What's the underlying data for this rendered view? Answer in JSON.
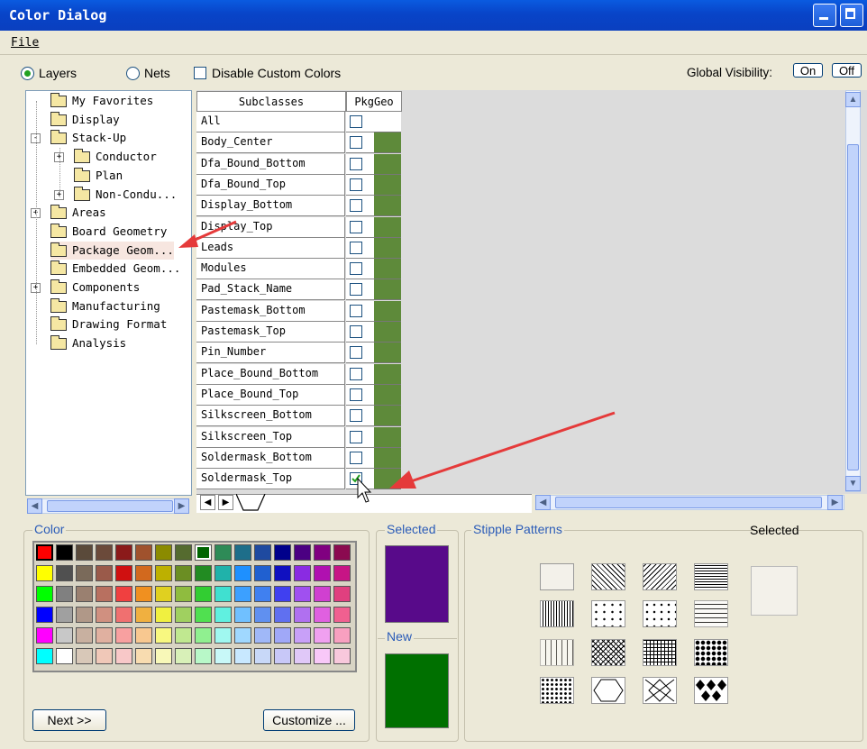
{
  "window": {
    "title": "Color Dialog"
  },
  "menu": {
    "file_label": "File"
  },
  "toolbar": {
    "layers_label": "Layers",
    "nets_label": "Nets",
    "disable_custom_label": "Disable Custom Colors",
    "global_visibility_label": "Global Visibility:",
    "on_label": "On",
    "off_label": "Off",
    "selected_radio": "Layers"
  },
  "tree": {
    "items": [
      {
        "label": "My Favorites",
        "level": 0,
        "expander": ""
      },
      {
        "label": "Display",
        "level": 0,
        "expander": ""
      },
      {
        "label": "Stack-Up",
        "level": 0,
        "expander": "-"
      },
      {
        "label": "Conductor",
        "level": 1,
        "expander": "+"
      },
      {
        "label": "Plan",
        "level": 1,
        "expander": ""
      },
      {
        "label": "Non-Condu...",
        "level": 1,
        "expander": "+"
      },
      {
        "label": "Areas",
        "level": 0,
        "expander": "+"
      },
      {
        "label": "Board Geometry",
        "level": 0,
        "expander": ""
      },
      {
        "label": "Package Geom...",
        "level": 0,
        "expander": "",
        "selected": true
      },
      {
        "label": "Embedded Geom...",
        "level": 0,
        "expander": ""
      },
      {
        "label": "Components",
        "level": 0,
        "expander": "+"
      },
      {
        "label": "Manufacturing",
        "level": 0,
        "expander": ""
      },
      {
        "label": "Drawing Format",
        "level": 0,
        "expander": ""
      },
      {
        "label": "Analysis",
        "level": 0,
        "expander": ""
      }
    ]
  },
  "grid": {
    "header_subclasses": "Subclasses",
    "header_col": "PkgGeo",
    "rows": [
      {
        "name": "All",
        "checked": false
      },
      {
        "name": "Body_Center",
        "checked": false
      },
      {
        "name": "Dfa_Bound_Bottom",
        "checked": false
      },
      {
        "name": "Dfa_Bound_Top",
        "checked": false
      },
      {
        "name": "Display_Bottom",
        "checked": false
      },
      {
        "name": "Display_Top",
        "checked": false
      },
      {
        "name": "Leads",
        "checked": false
      },
      {
        "name": "Modules",
        "checked": false
      },
      {
        "name": "Pad_Stack_Name",
        "checked": false
      },
      {
        "name": "Pastemask_Bottom",
        "checked": false
      },
      {
        "name": "Pastemask_Top",
        "checked": false
      },
      {
        "name": "Pin_Number",
        "checked": false
      },
      {
        "name": "Place_Bound_Bottom",
        "checked": false
      },
      {
        "name": "Place_Bound_Top",
        "checked": false
      },
      {
        "name": "Silkscreen_Bottom",
        "checked": false
      },
      {
        "name": "Silkscreen_Top",
        "checked": false
      },
      {
        "name": "Soldermask_Bottom",
        "checked": false
      },
      {
        "name": "Soldermask_Top",
        "checked": true
      }
    ],
    "layer_color": "#5e8a3a"
  },
  "color_panel": {
    "label": "Color",
    "next_label": "Next >>",
    "customize_label": "Customize ...",
    "palette": [
      [
        "#ff0000",
        "#000000",
        "#5a4a3a",
        "#6b4a3a",
        "#8b1a1a",
        "#a0522d",
        "#8b8b00",
        "#556b2f",
        "#006400",
        "#2e8b57",
        "#1e6e8a",
        "#1f4aa0",
        "#00008b",
        "#4b0082",
        "#800080",
        "#8b0a50"
      ],
      [
        "#ffff00",
        "#505050",
        "#7a6a5a",
        "#9a5a4a",
        "#d01010",
        "#d2691e",
        "#bdb000",
        "#6b8e23",
        "#228b22",
        "#20b2aa",
        "#1e90ff",
        "#2060d0",
        "#1010c0",
        "#8a2be2",
        "#b010b0",
        "#c71585"
      ],
      [
        "#00ff00",
        "#808080",
        "#9a8070",
        "#b87060",
        "#f04040",
        "#f09020",
        "#e0d020",
        "#8fbc3f",
        "#32cd32",
        "#40e0d0",
        "#3ca0ff",
        "#4080f0",
        "#4040f0",
        "#a050f0",
        "#d040d0",
        "#e0407f"
      ],
      [
        "#0000ff",
        "#a0a0a0",
        "#b09888",
        "#d09080",
        "#f07070",
        "#f0b040",
        "#f0f040",
        "#a0d060",
        "#50e050",
        "#60f0e0",
        "#70c0ff",
        "#6090f0",
        "#6070f0",
        "#b070f0",
        "#e060e0",
        "#f06090"
      ],
      [
        "#ff00ff",
        "#c8c8c8",
        "#c8b0a0",
        "#e0b0a0",
        "#f8a0a0",
        "#f8c890",
        "#f8f880",
        "#c0e890",
        "#90f090",
        "#a0f8f0",
        "#a0d8ff",
        "#a0b8f8",
        "#a0a8f8",
        "#c8a0f8",
        "#f0a0f0",
        "#f8a0c0"
      ],
      [
        "#00ffff",
        "#ffffff",
        "#d8c8b8",
        "#f0c8b8",
        "#f8c8c8",
        "#f8dcb0",
        "#f8f8b8",
        "#d8f0b8",
        "#b8f8c8",
        "#c8f8f8",
        "#c8e8ff",
        "#c8d8f8",
        "#c8c8f8",
        "#e0c8f8",
        "#f8c8f8",
        "#f8c8dc"
      ]
    ]
  },
  "selected_panel": {
    "label": "Selected",
    "color": "#580a8a"
  },
  "new_panel": {
    "label": "New",
    "color": "#007000"
  },
  "stipple": {
    "label": "Stipple Patterns",
    "selected_label": "Selected"
  }
}
